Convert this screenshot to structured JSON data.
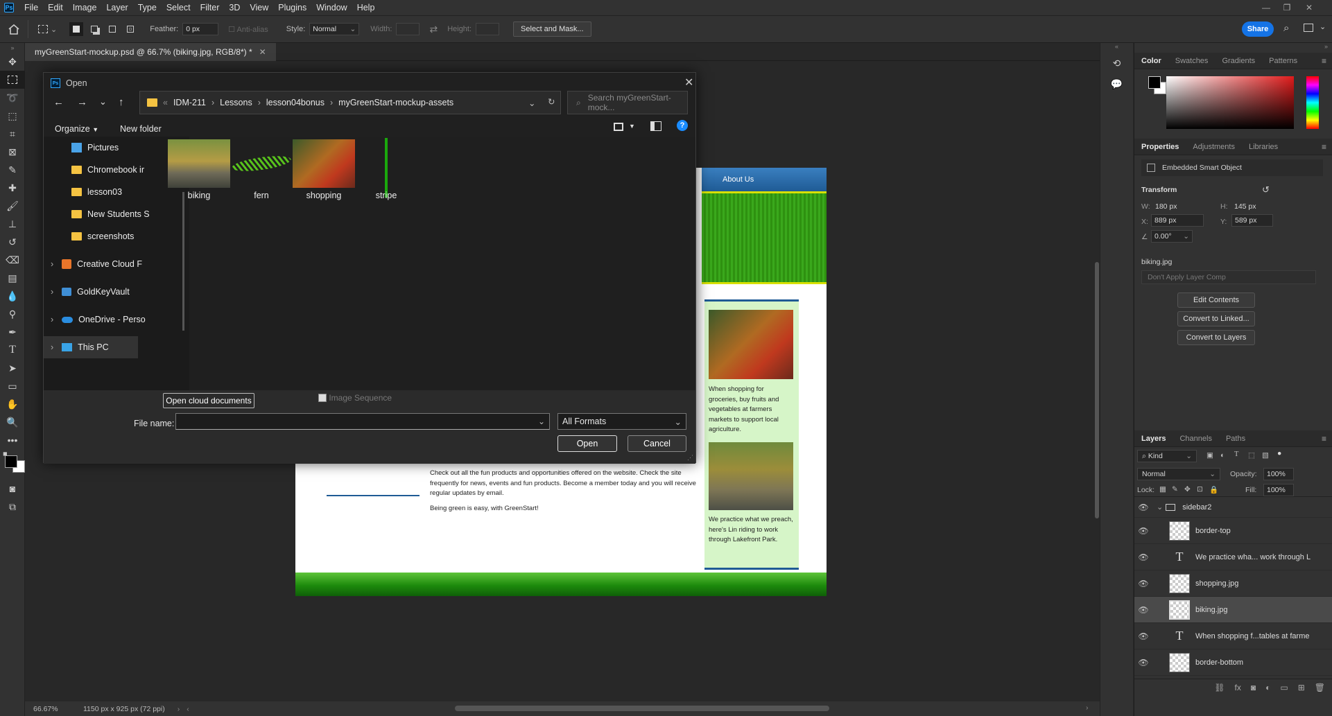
{
  "menubar": {
    "logo": "Ps",
    "items": [
      "File",
      "Edit",
      "Image",
      "Layer",
      "Type",
      "Select",
      "Filter",
      "3D",
      "View",
      "Plugins",
      "Window",
      "Help"
    ]
  },
  "options": {
    "feather_label": "Feather:",
    "feather_value": "0 px",
    "antialias_label": "Anti-alias",
    "style_label": "Style:",
    "style_value": "Normal",
    "width_label": "Width:",
    "height_label": "Height:",
    "select_mask_label": "Select and Mask...",
    "share_label": "Share"
  },
  "document": {
    "tab_title": "myGreenStart-mockup.psd @ 66.7% (biking.jpg, RGB/8*) *",
    "nav_about": "About Us",
    "body_text": "Check out all the fun products and opportunities offered on the website. Check the site frequently for news, events and fun products. Become a member today and you will receive regular updates by email.",
    "tagline": "Being green is easy, with GreenStart!",
    "sidebar_text_1": "When shopping for groceries, buy fruits and vegetables at farmers markets to support local agriculture.",
    "sidebar_text_2": "We practice what we preach, here's Lin riding to work through Lakefront Park."
  },
  "status": {
    "zoom": "66.67%",
    "doc_info": "1150 px x 925 px (72 ppi)"
  },
  "dialog": {
    "title": "Open",
    "breadcrumb": [
      "IDM-211",
      "Lessons",
      "lesson04bonus",
      "myGreenStart-mockup-assets"
    ],
    "search_placeholder": "Search myGreenStart-mock...",
    "organize_label": "Organize",
    "new_folder_label": "New folder",
    "nav_items": [
      {
        "label": "Pictures",
        "icon": "pictures-icon"
      },
      {
        "label": "Chromebook ir",
        "icon": "folder-icon"
      },
      {
        "label": "lesson03",
        "icon": "folder-icon"
      },
      {
        "label": "New Students S",
        "icon": "folder-icon"
      },
      {
        "label": "screenshots",
        "icon": "folder-icon"
      },
      {
        "label": "Creative Cloud F",
        "icon": "creative-cloud-icon"
      },
      {
        "label": "GoldKeyVault",
        "icon": "vault-icon"
      },
      {
        "label": "OneDrive - Perso",
        "icon": "onedrive-icon"
      },
      {
        "label": "This PC",
        "icon": "pc-icon"
      }
    ],
    "files": [
      "biking",
      "fern",
      "shopping",
      "stripe"
    ],
    "open_cloud_label": "Open cloud documents",
    "image_sequence_label": "Image Sequence",
    "file_name_label": "File name:",
    "file_name_value": "",
    "format_value": "All Formats",
    "open_label": "Open",
    "cancel_label": "Cancel"
  },
  "color_panel": {
    "tabs": [
      "Color",
      "Swatches",
      "Gradients",
      "Patterns"
    ]
  },
  "properties_panel": {
    "tabs": [
      "Properties",
      "Adjustments",
      "Libraries"
    ],
    "object_type": "Embedded Smart Object",
    "transform_label": "Transform",
    "w_label": "W:",
    "w_value": "180 px",
    "h_label": "H:",
    "h_value": "145 px",
    "x_label": "X:",
    "x_value": "889 px",
    "y_label": "Y:",
    "y_value": "589 px",
    "angle_value": "0.00°",
    "source_name": "biking.jpg",
    "layer_comp_value": "Don't Apply Layer Comp",
    "edit_contents_label": "Edit Contents",
    "convert_linked_label": "Convert to Linked...",
    "convert_layers_label": "Convert to Layers"
  },
  "layers_panel": {
    "tabs": [
      "Layers",
      "Channels",
      "Paths"
    ],
    "kind_label": "Kind",
    "blend_mode": "Normal",
    "opacity_label": "Opacity:",
    "opacity_value": "100%",
    "lock_label": "Lock:",
    "fill_label": "Fill:",
    "fill_value": "100%",
    "layers": [
      {
        "name": "sidebar2",
        "kind": "group"
      },
      {
        "name": "border-top",
        "kind": "smart"
      },
      {
        "name": "We practice wha... work through L",
        "kind": "text"
      },
      {
        "name": "shopping.jpg",
        "kind": "smart"
      },
      {
        "name": "biking.jpg",
        "kind": "smart"
      },
      {
        "name": "When shopping f...tables at farme",
        "kind": "text"
      },
      {
        "name": "border-bottom",
        "kind": "smart"
      }
    ]
  },
  "colors": {
    "accent": "#1473e6",
    "green": "#2e9a10",
    "sidebar_bg": "#d6f5c8"
  }
}
